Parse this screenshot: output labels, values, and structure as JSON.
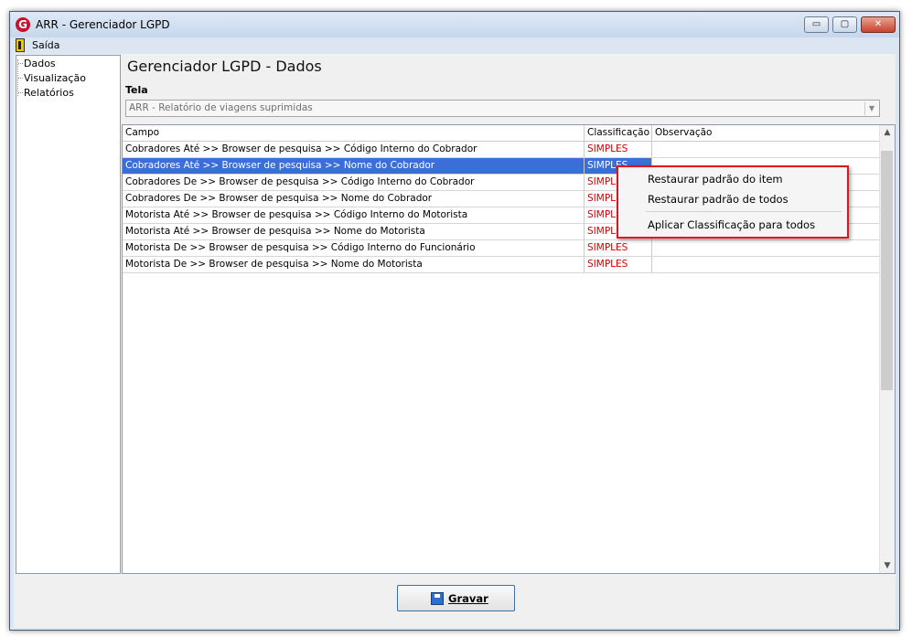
{
  "window": {
    "title": "ARR - Gerenciador LGPD",
    "app_icon": "G",
    "minimize": "▭",
    "maximize": "▢",
    "close": "✕"
  },
  "menu": {
    "exit_label": "Saída"
  },
  "sidebar": {
    "items": [
      {
        "label": "Dados"
      },
      {
        "label": "Visualização"
      },
      {
        "label": "Relatórios"
      }
    ]
  },
  "main": {
    "title": "Gerenciador LGPD - Dados",
    "tela_label": "Tela",
    "tela_value": "ARR - Relatório de viagens suprimidas"
  },
  "grid": {
    "columns": [
      "Campo",
      "Classificação",
      "Observação"
    ],
    "rows": [
      {
        "campo": "Cobradores Até >> Browser de pesquisa >> Código Interno do Cobrador",
        "classificacao": "SIMPLES",
        "observacao": ""
      },
      {
        "campo": "Cobradores Até >> Browser de pesquisa >> Nome do Cobrador",
        "classificacao": "SIMPLES",
        "observacao": ""
      },
      {
        "campo": "Cobradores De >> Browser de pesquisa >> Código Interno do Cobrador",
        "classificacao": "SIMPLES",
        "observacao": ""
      },
      {
        "campo": "Cobradores De >> Browser de pesquisa >> Nome do Cobrador",
        "classificacao": "SIMPLES",
        "observacao": ""
      },
      {
        "campo": "Motorista Até >> Browser de pesquisa >> Código Interno do Motorista",
        "classificacao": "SIMPLES",
        "observacao": ""
      },
      {
        "campo": "Motorista Até >> Browser de pesquisa >> Nome do Motorista",
        "classificacao": "SIMPLES",
        "observacao": ""
      },
      {
        "campo": "Motorista De >> Browser de pesquisa >> Código Interno do Funcionário",
        "classificacao": "SIMPLES",
        "observacao": ""
      },
      {
        "campo": "Motorista De >> Browser de pesquisa >> Nome do Motorista",
        "classificacao": "SIMPLES",
        "observacao": ""
      }
    ]
  },
  "context_menu": {
    "items": [
      {
        "label": "Restaurar padrão do item"
      },
      {
        "label": "Restaurar padrão de todos"
      },
      {
        "label": "Aplicar Classificação para todos"
      }
    ]
  },
  "footer": {
    "save_label": "Gravar"
  },
  "colors": {
    "classification": "#d40000",
    "selection": "#3b6ed6",
    "highlight_border": "#e0151b"
  }
}
